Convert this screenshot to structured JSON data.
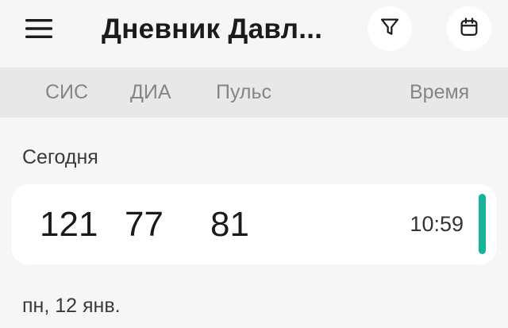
{
  "app_bar": {
    "title": "Дневник Давл...",
    "menu_icon": "menu-icon",
    "filter_icon": "filter-icon",
    "calendar_icon": "calendar-icon"
  },
  "columns": {
    "sys": "СИС",
    "dia": "ДИА",
    "pulse": "Пульс",
    "time": "Время"
  },
  "sections": [
    {
      "title": "Сегодня",
      "records": [
        {
          "sys": "121",
          "dia": "77",
          "pulse": "81",
          "time": "10:59",
          "indicator_color": "#17b39a"
        }
      ]
    },
    {
      "title": "пн, 12 янв."
    }
  ],
  "colors": {
    "accent": "#17b39a",
    "background": "#f6f6f6",
    "header_row": "#e8e8e8"
  }
}
